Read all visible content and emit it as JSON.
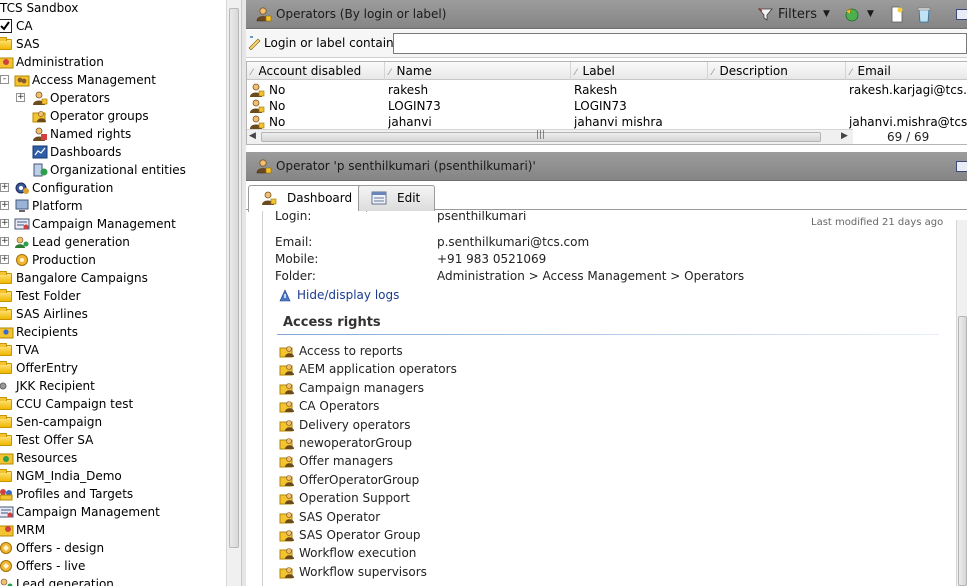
{
  "tree": {
    "items": [
      {
        "label": "TCS Sandbox",
        "depth": 0,
        "icon": "none",
        "expander": "none"
      },
      {
        "label": "CA",
        "depth": 0,
        "icon": "checkbox",
        "expander": "none"
      },
      {
        "label": "SAS",
        "depth": 0,
        "icon": "folder",
        "expander": "none"
      },
      {
        "label": "Administration",
        "depth": 0,
        "icon": "admin",
        "expander": "none"
      },
      {
        "label": "Access Management",
        "depth": 1,
        "icon": "access",
        "expander": "-"
      },
      {
        "label": "Operators",
        "depth": 2,
        "icon": "operator",
        "expander": "+"
      },
      {
        "label": "Operator groups",
        "depth": 2,
        "icon": "operator-group",
        "expander": "none"
      },
      {
        "label": "Named rights",
        "depth": 2,
        "icon": "named-rights",
        "expander": "none"
      },
      {
        "label": "Dashboards",
        "depth": 2,
        "icon": "dashboard",
        "expander": "none"
      },
      {
        "label": "Organizational entities",
        "depth": 2,
        "icon": "org",
        "expander": "none"
      },
      {
        "label": "Configuration",
        "depth": 1,
        "icon": "config",
        "expander": "+"
      },
      {
        "label": "Platform",
        "depth": 1,
        "icon": "platform",
        "expander": "+"
      },
      {
        "label": "Campaign Management",
        "depth": 1,
        "icon": "campaign",
        "expander": "+"
      },
      {
        "label": "Lead generation",
        "depth": 1,
        "icon": "lead",
        "expander": "+"
      },
      {
        "label": "Production",
        "depth": 1,
        "icon": "production",
        "expander": "+"
      },
      {
        "label": "Bangalore Campaigns",
        "depth": 0,
        "icon": "folder",
        "expander": "none"
      },
      {
        "label": "Test Folder",
        "depth": 0,
        "icon": "folder",
        "expander": "none"
      },
      {
        "label": "SAS Airlines",
        "depth": 0,
        "icon": "folder",
        "expander": "none"
      },
      {
        "label": "Recipients",
        "depth": 0,
        "icon": "recipients",
        "expander": "none"
      },
      {
        "label": "TVA",
        "depth": 0,
        "icon": "folder",
        "expander": "none"
      },
      {
        "label": "OfferEntry",
        "depth": 0,
        "icon": "folder",
        "expander": "none"
      },
      {
        "label": "JKK Recipient",
        "depth": 0,
        "icon": "dot",
        "expander": "none"
      },
      {
        "label": "CCU Campaign test",
        "depth": 0,
        "icon": "folder",
        "expander": "none"
      },
      {
        "label": "Sen-campaign",
        "depth": 0,
        "icon": "folder",
        "expander": "none"
      },
      {
        "label": "Test Offer SA",
        "depth": 0,
        "icon": "folder",
        "expander": "none"
      },
      {
        "label": "Resources",
        "depth": 0,
        "icon": "resources",
        "expander": "none"
      },
      {
        "label": "NGM_India_Demo",
        "depth": 0,
        "icon": "folder",
        "expander": "none"
      },
      {
        "label": "Profiles and Targets",
        "depth": 0,
        "icon": "profiles",
        "expander": "none"
      },
      {
        "label": "Campaign Management",
        "depth": 0,
        "icon": "campaign",
        "expander": "none"
      },
      {
        "label": "MRM",
        "depth": 0,
        "icon": "mrm",
        "expander": "none"
      },
      {
        "label": "Offers - design",
        "depth": 0,
        "icon": "offers",
        "expander": "none"
      },
      {
        "label": "Offers - live",
        "depth": 0,
        "icon": "offers",
        "expander": "none"
      },
      {
        "label": "Lead generation",
        "depth": 0,
        "icon": "lead",
        "expander": "none"
      }
    ]
  },
  "list_panel": {
    "title": "Operators (By login or label)",
    "filters_label": "Filters",
    "filter_label": "Login or label contains:",
    "filter_value": "",
    "columns": [
      "Account disabled",
      "Name",
      "Label",
      "Description",
      "Email"
    ],
    "rows": [
      {
        "disabled": "No",
        "name": "rakesh",
        "label": "Rakesh",
        "description": "",
        "email": "rakesh.karjagi@tcs.co"
      },
      {
        "disabled": "No",
        "name": "LOGIN73",
        "label": "LOGIN73",
        "description": "",
        "email": ""
      },
      {
        "disabled": "No",
        "name": "jahanvi",
        "label": "jahanvi mishra",
        "description": "",
        "email": "jahanvi.mishra@tcs.co"
      }
    ],
    "count": "69 / 69",
    "scroll_grip": "|||"
  },
  "detail_panel": {
    "title": "Operator 'p senthilkumari (psenthilkumari)'",
    "tabs": [
      {
        "label": "Dashboard",
        "active": true
      },
      {
        "label": "Edit",
        "active": false
      }
    ],
    "last_modified": "Last modified 21 days ago",
    "fields": [
      {
        "label": "Login:",
        "value": "psenthilkumari"
      },
      {
        "label": "Email:",
        "value": "p.senthilkumari@tcs.com"
      },
      {
        "label": "Mobile:",
        "value": "+91 983 0521069"
      },
      {
        "label": "Folder:",
        "value": "Administration > Access Management > Operators"
      }
    ],
    "logs_link": "Hide/display logs",
    "access_rights_title": "Access rights",
    "access_rights": [
      "Access to reports",
      "AEM application operators",
      "Campaign managers",
      "CA Operators",
      "Delivery operators",
      "newoperatorGroup",
      "Offer managers",
      "OfferOperatorGroup",
      "Operation Support",
      "SAS Operator",
      "SAS Operator Group",
      "Workflow execution",
      "Workflow supervisors"
    ]
  },
  "colors": {
    "header_bar": "#8f8f8f",
    "link": "#1a3c8f",
    "folder": "#f4c430",
    "rule": "#7fa7d6"
  }
}
